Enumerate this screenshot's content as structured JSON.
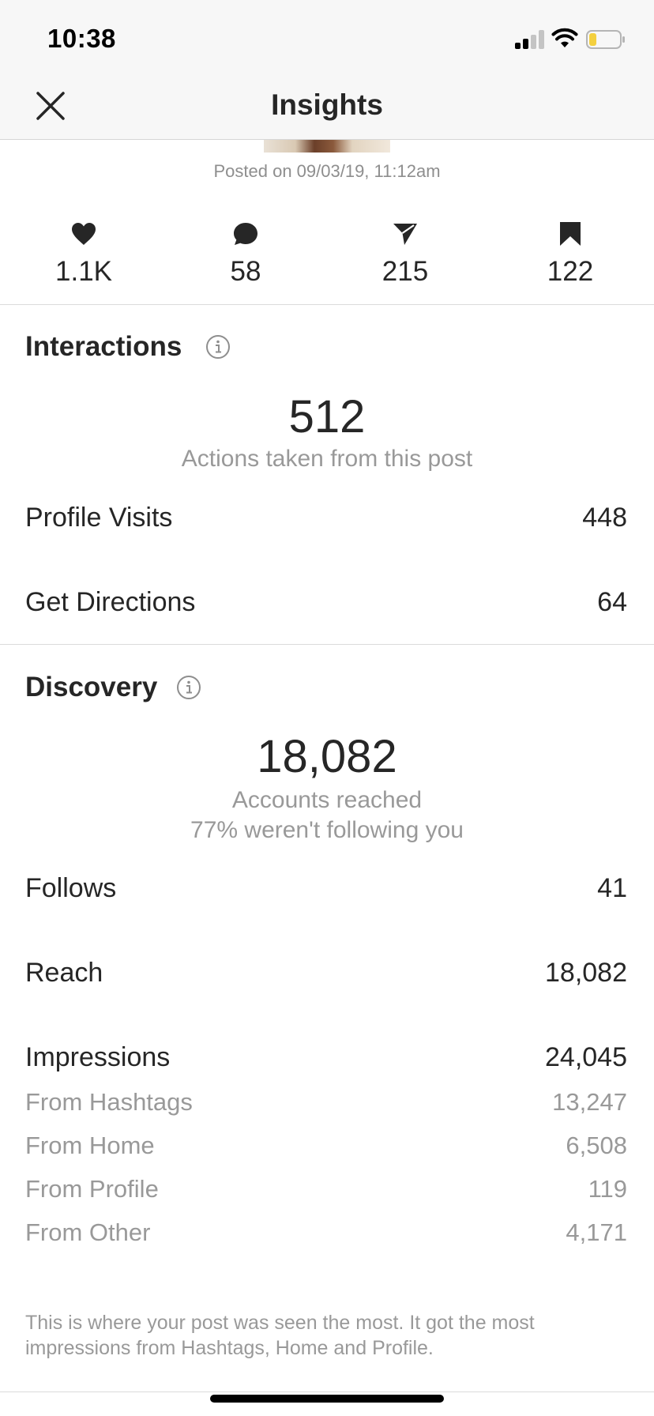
{
  "status_bar": {
    "time": "10:38"
  },
  "header": {
    "title": "Insights"
  },
  "post": {
    "posted": "Posted on 09/03/19, 11:12am"
  },
  "stats": {
    "likes": "1.1K",
    "comments": "58",
    "shares": "215",
    "saves": "122"
  },
  "interactions": {
    "title": "Interactions",
    "total": "512",
    "caption": "Actions taken from this post",
    "rows": [
      {
        "label": "Profile Visits",
        "value": "448"
      },
      {
        "label": "Get Directions",
        "value": "64"
      }
    ]
  },
  "discovery": {
    "title": "Discovery",
    "total": "18,082",
    "caption": "Accounts reached",
    "caption2": "77% weren't following you",
    "rows": [
      {
        "label": "Follows",
        "value": "41"
      },
      {
        "label": "Reach",
        "value": "18,082"
      },
      {
        "label": "Impressions",
        "value": "24,045"
      }
    ],
    "impression_sources": [
      {
        "label": "From Hashtags",
        "value": "13,247"
      },
      {
        "label": "From Home",
        "value": "6,508"
      },
      {
        "label": "From Profile",
        "value": "119"
      },
      {
        "label": "From Other",
        "value": "4,171"
      }
    ],
    "note": "This is where your post was seen the most. It got the most impressions from Hashtags, Home and Profile."
  },
  "icons": {
    "close": "close-icon",
    "like": "heart-icon",
    "comment": "comment-icon",
    "share": "send-icon",
    "save": "bookmark-icon",
    "info": "info-icon"
  }
}
